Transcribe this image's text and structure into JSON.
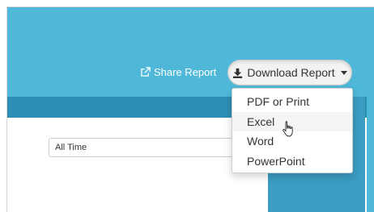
{
  "header": {
    "share_label": "Share Report",
    "download_label": "Download Report"
  },
  "filters": {
    "time_range": "All Time"
  },
  "download_menu": {
    "items": [
      {
        "label": "PDF or Print"
      },
      {
        "label": "Excel"
      },
      {
        "label": "Word"
      },
      {
        "label": "PowerPoint"
      }
    ],
    "hovered": "Excel"
  },
  "icons": {
    "share": "external-link-icon",
    "download": "download-icon",
    "caret": "caret-down-icon",
    "pointer": "hand-pointer-icon"
  },
  "colors": {
    "header_blue": "#4fb8d8",
    "panel_blue": "#2e8fb4",
    "side_blue": "#3b9dc2"
  }
}
